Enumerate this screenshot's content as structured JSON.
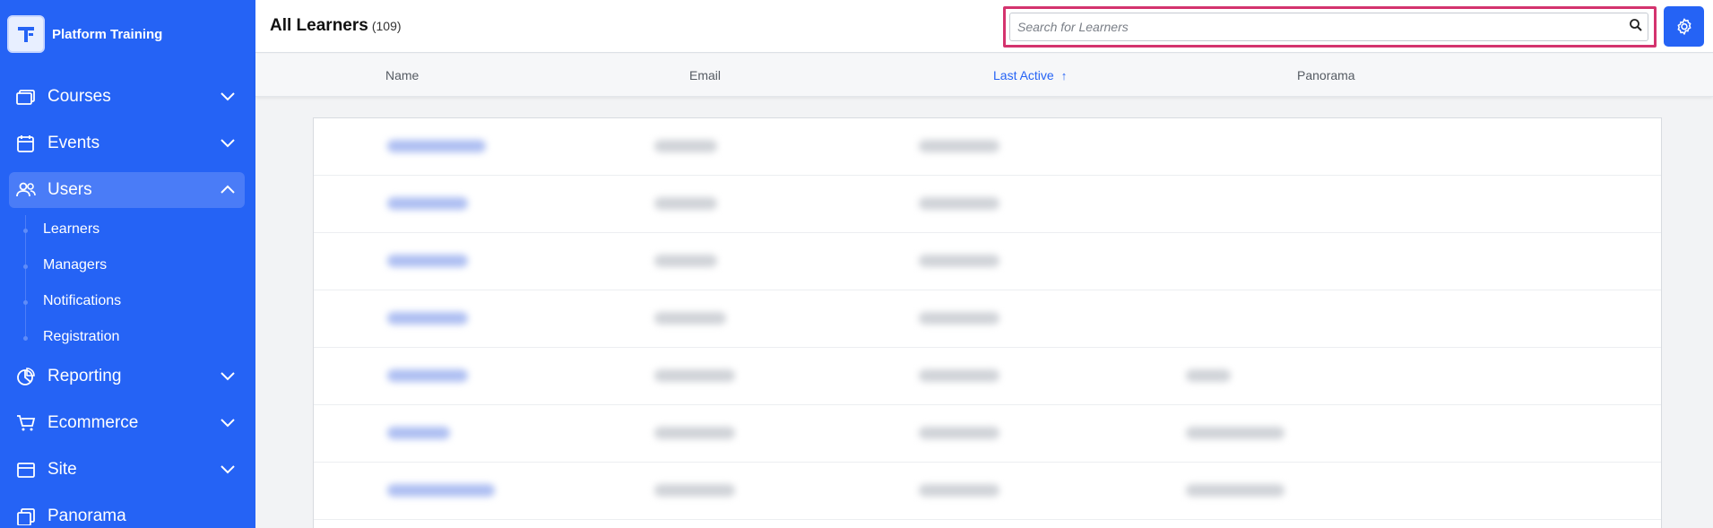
{
  "sidebar": {
    "brand": "Platform Training",
    "nav": [
      {
        "label": "Courses",
        "icon": "courses-icon",
        "expanded": false
      },
      {
        "label": "Events",
        "icon": "calendar-icon",
        "expanded": false
      },
      {
        "label": "Users",
        "icon": "users-icon",
        "expanded": true
      },
      {
        "label": "Reporting",
        "icon": "pie-chart-icon",
        "expanded": false
      },
      {
        "label": "Ecommerce",
        "icon": "cart-icon",
        "expanded": false
      },
      {
        "label": "Site",
        "icon": "site-icon",
        "expanded": false
      },
      {
        "label": "Panorama",
        "icon": "panorama-icon",
        "expanded": false
      }
    ],
    "users_sub": [
      "Learners",
      "Managers",
      "Notifications",
      "Registration"
    ]
  },
  "header": {
    "title": "All Learners",
    "count": "(109)",
    "search_placeholder": "Search for Learners"
  },
  "columns": {
    "name": "Name",
    "email": "Email",
    "last_active": "Last Active",
    "panorama": "Panorama"
  },
  "table": {
    "note": "row contents are blurred in the screenshot",
    "rows": [
      {
        "has_panorama": false
      },
      {
        "has_panorama": false
      },
      {
        "has_panorama": false
      },
      {
        "has_panorama": false
      },
      {
        "has_panorama": true
      },
      {
        "has_panorama": true
      },
      {
        "has_panorama": true
      }
    ]
  },
  "colors": {
    "sidebar_bg": "#2563f5",
    "accent": "#2563f5",
    "search_highlight": "#d4336e"
  }
}
